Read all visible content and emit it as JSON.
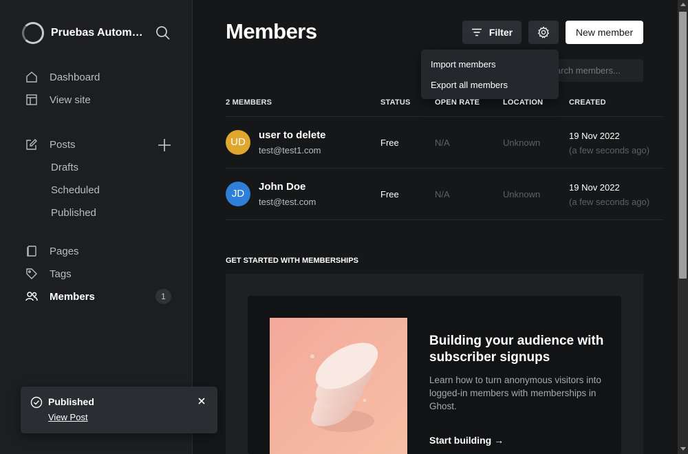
{
  "sidebar": {
    "site_name": "Pruebas Automatizadas",
    "nav_top": [
      {
        "label": "Dashboard",
        "icon": "home-icon"
      },
      {
        "label": "View site",
        "icon": "layout-icon"
      }
    ],
    "posts": {
      "label": "Posts",
      "icon": "edit-icon",
      "sub": [
        "Drafts",
        "Scheduled",
        "Published"
      ]
    },
    "nav_bottom": [
      {
        "label": "Pages",
        "icon": "page-icon"
      },
      {
        "label": "Tags",
        "icon": "tag-icon"
      },
      {
        "label": "Members",
        "icon": "users-icon",
        "active": true,
        "badge": "1"
      }
    ]
  },
  "toast": {
    "title": "Published",
    "link": "View Post"
  },
  "header": {
    "title": "Members",
    "filter_label": "Filter",
    "new_member_label": "New member"
  },
  "search": {
    "placeholder": "Search members..."
  },
  "dropdown": {
    "items": [
      "Import members",
      "Export all members"
    ]
  },
  "table": {
    "columns": [
      "2 MEMBERS",
      "STATUS",
      "OPEN RATE",
      "LOCATION",
      "CREATED"
    ],
    "rows": [
      {
        "initials": "UD",
        "avatar_color": "#e0a72e",
        "name": "user to delete",
        "email": "test@test1.com",
        "status": "Free",
        "open_rate": "N/A",
        "location": "Unknown",
        "created": "19 Nov 2022",
        "created_rel": "(a few seconds ago)"
      },
      {
        "initials": "JD",
        "avatar_color": "#2f7fd8",
        "name": "John Doe",
        "email": "test@test.com",
        "status": "Free",
        "open_rate": "N/A",
        "location": "Unknown",
        "created": "19 Nov 2022",
        "created_rel": "(a few seconds ago)"
      }
    ]
  },
  "get_started": {
    "section_title": "GET STARTED WITH MEMBERSHIPS",
    "heading": "Building your audience with subscriber signups",
    "text": "Learn how to turn anonymous visitors into logged-in members with memberships in Ghost.",
    "cta": "Start building →"
  }
}
